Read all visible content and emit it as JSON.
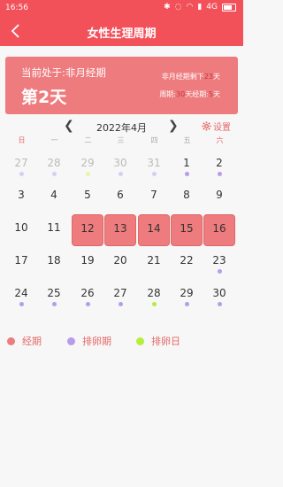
{
  "status_bar": {
    "time": "16:56",
    "network": "4G"
  },
  "title_bar": {
    "title": "女性生理周期"
  },
  "summary": {
    "status": "当前处于:非月经期",
    "day": "第2天",
    "remaining_prefix": "非月经期剩下",
    "remaining_value": "23",
    "remaining_suffix": "天",
    "cycle_label": "周期:",
    "cycle_value": "30",
    "cycle_unit": "天",
    "period_label": "经期:",
    "period_value": "5",
    "period_unit": "天"
  },
  "calendar": {
    "month": "2022年4月",
    "settings_label": "设置",
    "weekdays": [
      "日",
      "一",
      "二",
      "三",
      "四",
      "五",
      "六"
    ],
    "weeks": [
      [
        {
          "d": "27",
          "grey": true,
          "dot": "faded"
        },
        {
          "d": "28",
          "grey": true,
          "dot": "faded"
        },
        {
          "d": "29",
          "grey": true,
          "dot": "faded-green"
        },
        {
          "d": "30",
          "grey": true,
          "dot": "faded"
        },
        {
          "d": "31",
          "grey": true,
          "dot": "faded"
        },
        {
          "d": "1",
          "dot": "purple"
        },
        {
          "d": "2",
          "dot": "purple"
        }
      ],
      [
        {
          "d": "3"
        },
        {
          "d": "4"
        },
        {
          "d": "5"
        },
        {
          "d": "6"
        },
        {
          "d": "7"
        },
        {
          "d": "8"
        },
        {
          "d": "9"
        }
      ],
      [
        {
          "d": "10"
        },
        {
          "d": "11"
        },
        {
          "d": "12",
          "period": true
        },
        {
          "d": "13",
          "period": true
        },
        {
          "d": "14",
          "period": true
        },
        {
          "d": "15",
          "period": true
        },
        {
          "d": "16",
          "period": true
        }
      ],
      [
        {
          "d": "17"
        },
        {
          "d": "18"
        },
        {
          "d": "19"
        },
        {
          "d": "20"
        },
        {
          "d": "21"
        },
        {
          "d": "22"
        },
        {
          "d": "23",
          "dot": "purple"
        }
      ],
      [
        {
          "d": "24",
          "dot": "purple"
        },
        {
          "d": "25",
          "dot": "purple"
        },
        {
          "d": "26",
          "dot": "purple"
        },
        {
          "d": "27",
          "dot": "purple"
        },
        {
          "d": "28",
          "dot": "green"
        },
        {
          "d": "29",
          "dot": "purple"
        },
        {
          "d": "30",
          "dot": "purple"
        }
      ]
    ]
  },
  "legend": [
    {
      "label": "经期",
      "color": "#ee7b7d"
    },
    {
      "label": "排卵期",
      "color": "#b89bea"
    },
    {
      "label": "排卵日",
      "color": "#b5ee3b"
    }
  ]
}
